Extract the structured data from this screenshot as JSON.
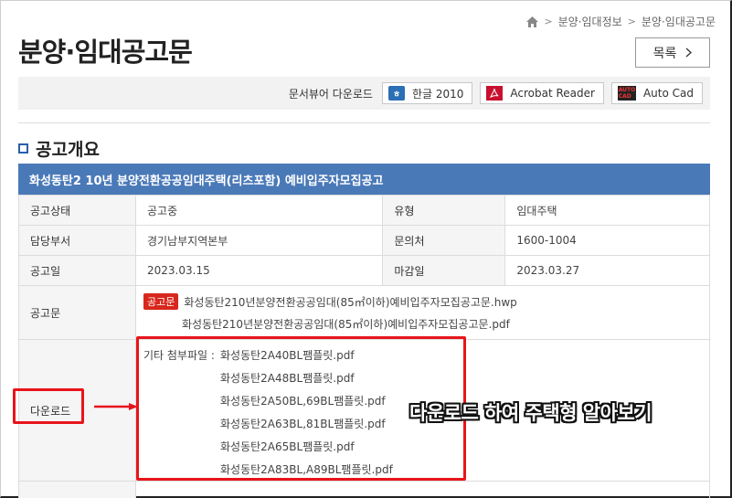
{
  "breadcrumb": {
    "home_icon": "home-icon",
    "items": [
      "분양·임대정보",
      "분양·임대공고문"
    ]
  },
  "page_title": "분양·임대공고문",
  "list_button": {
    "label": "목록",
    "icon": "chevron-right-icon"
  },
  "viewer_bar": {
    "label": "문서뷰어 다운로드",
    "buttons": [
      {
        "label": "한글 2010",
        "icon": "hwp-icon"
      },
      {
        "label": "Acrobat Reader",
        "icon": "pdf-icon"
      },
      {
        "label": "Auto Cad",
        "icon": "autocad-icon"
      }
    ]
  },
  "section_title": "공고개요",
  "notice": {
    "title": "화성동탄2 10년 분양전환공공임대주택(리츠포함) 예비입주자모집공고",
    "status_label": "공고상태",
    "status_value": "공고중",
    "type_label": "유형",
    "type_value": "임대주택",
    "dept_label": "담당부서",
    "dept_value": "경기남부지역본부",
    "contact_label": "문의처",
    "contact_value": "1600-1004",
    "date_label": "공고일",
    "date_value": "2023.03.15",
    "deadline_label": "마감일",
    "deadline_value": "2023.03.27",
    "doc_label": "공고문",
    "doc_badge": "공고문",
    "doc_files": [
      "화성동탄210년분양전환공공임대(85㎡이하)예비입주자모집공고문.hwp",
      "화성동탄210년분양전환공공임대(85㎡이하)예비입주자모집공고문.pdf"
    ],
    "download_label": "다운로드",
    "attach_label": "기타 첨부파일 :",
    "attach_files": [
      "화성동탄2A40BL팸플릿.pdf",
      "화성동탄2A48BL팸플릿.pdf",
      "화성동탄2A50BL,69BL팸플릿.pdf",
      "화성동탄2A63BL,81BL팸플릿.pdf",
      "화성동탄2A65BL팸플릿.pdf",
      "화성동탄2A83BL,A89BL팸플릿.pdf"
    ]
  },
  "annotation": {
    "text": "다운로드 하여 주택형 알아보기",
    "highlight_color": "#e8141b"
  }
}
